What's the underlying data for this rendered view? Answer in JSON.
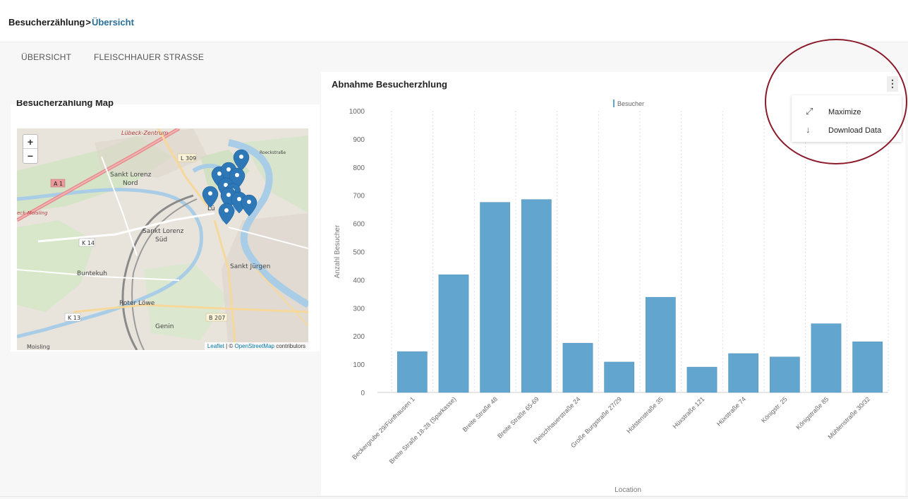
{
  "breadcrumb": {
    "parent": "Besucherzählung",
    "separator": ">",
    "current": "Übersicht"
  },
  "tabs": [
    {
      "label": "ÜBERSICHT"
    },
    {
      "label": "FLEISCHHAUER STRASSE"
    }
  ],
  "map_panel": {
    "title": "Besucherzählung Map",
    "zoom_in": "+",
    "zoom_out": "−",
    "attribution_leaflet": "Leaflet",
    "attribution_sep": " | © ",
    "attribution_osm": "OpenStreetMap",
    "attribution_contrib": " contributors",
    "labels": {
      "lubeck_zentrum": "Lübeck-Zentrum",
      "l309": "L 309",
      "a1": "A 1",
      "sankt_lorenz_nord": "Sankt Lorenz\nNord",
      "sankt_lorenz_sud": "Sankt Lorenz\nSüd",
      "k14": "K 14",
      "buntekuh": "Buntekuh",
      "sankt_jurgen": "Sankt Jürgen",
      "roter_lowe": "Roter Löwe",
      "k13": "K 13",
      "b207": "B 207",
      "genin": "Genin",
      "moisling": "Moisling",
      "roeckstrasse": "Roeckstraße",
      "lu": "Lü"
    },
    "marker_color": "#2e78b8"
  },
  "chart_panel": {
    "title": "Abnahme  Besucherzhlung",
    "menu_icon": "⋮",
    "menu": [
      {
        "label": "Maximize",
        "icon": "maximize-icon"
      },
      {
        "label": "Download Data",
        "icon": "download-icon"
      }
    ]
  },
  "chart_data": {
    "type": "bar",
    "legend": "Besucher",
    "ylabel": "Anzahl Besucher",
    "xlabel": "Location",
    "ylim": [
      0,
      1000
    ],
    "yticks": [
      0,
      100,
      200,
      300,
      400,
      500,
      600,
      700,
      800,
      900,
      1000
    ],
    "bar_color": "#62a6cf",
    "categories": [
      "Beckergrube 29/Fünfhausen 1",
      "Breite Straße 18-28 (Sparkasse)",
      "Breite Straße 48",
      "Breite Straße 65-69",
      "Fleischhauerstraße 24",
      "Große Burgstraße 27/29",
      "Holstenstraße 35",
      "Hüxstraße 121",
      "Hüxstraße 74",
      "Königstr. 25",
      "Königstraße 85",
      "Mühlenstraße 30/32"
    ],
    "values": [
      145,
      418,
      675,
      685,
      175,
      108,
      338,
      90,
      138,
      126,
      244,
      180
    ]
  }
}
